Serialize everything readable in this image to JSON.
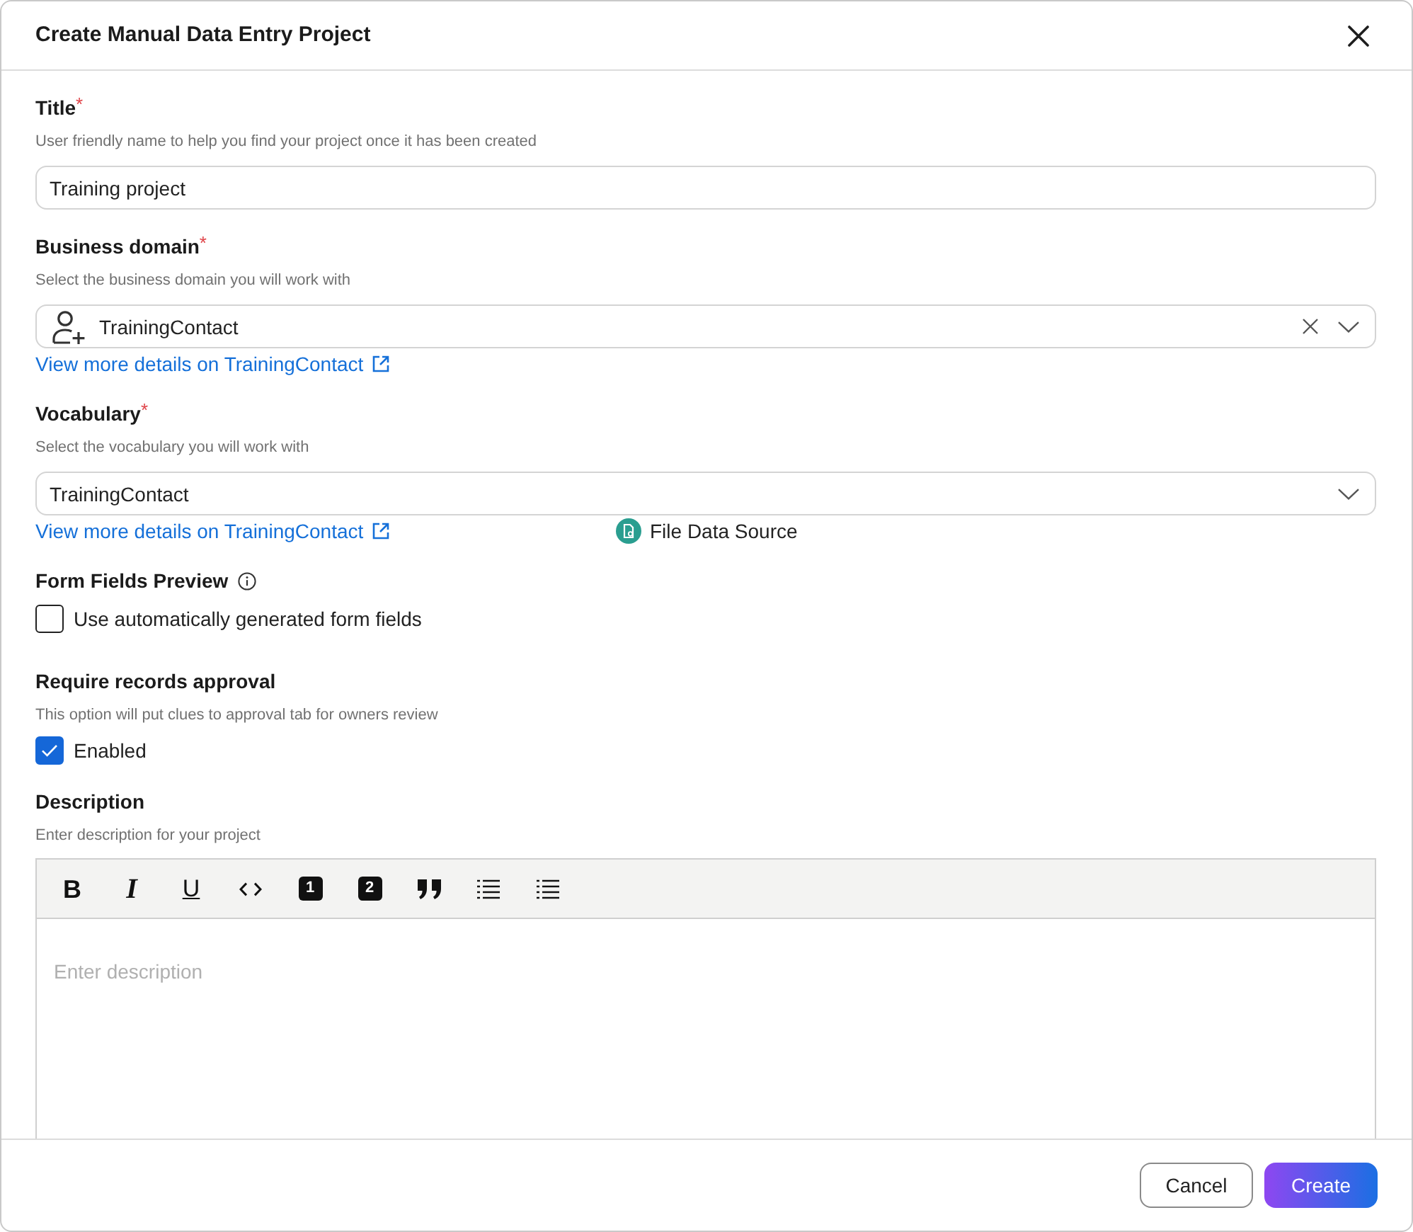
{
  "dialog": {
    "title": "Create Manual Data Entry Project"
  },
  "sections": [
    {
      "kind": "text",
      "label": "Title",
      "required_mark": "*",
      "hint": "User friendly name to help you find your project once it has been created",
      "value": "Training project"
    },
    {
      "kind": "select",
      "label": "Business domain",
      "required_mark": "*",
      "hint": "Select the business domain you will work with",
      "value": "TrainingContact",
      "leading_icon": true,
      "clearable": true,
      "link": "View more details on TrainingContact"
    },
    {
      "kind": "select",
      "label": "Vocabulary",
      "required_mark": "*",
      "hint": "Select the vocabulary you will work with",
      "value": "TrainingContact",
      "leading_icon": false,
      "clearable": false,
      "link": "View more details on TrainingContact",
      "source": "File Data Source"
    },
    {
      "kind": "checkbox",
      "label": "Form Fields Preview",
      "info": true,
      "option": {
        "label": "Use automatically generated form fields",
        "checked": false
      }
    },
    {
      "kind": "checkbox",
      "label": "Require records approval",
      "hint": "This option will put clues to approval tab for owners review",
      "option": {
        "label": "Enabled",
        "checked": true
      }
    },
    {
      "kind": "editor",
      "label": "Description",
      "hint": "Enter description for your project",
      "toolbar": [
        {
          "kind": "bold",
          "label": "B"
        },
        {
          "kind": "italic",
          "label": "I"
        },
        {
          "kind": "underline",
          "label": "U"
        },
        {
          "kind": "code"
        },
        {
          "kind": "heading",
          "label": "1"
        },
        {
          "kind": "heading",
          "label": "2"
        },
        {
          "kind": "quote"
        },
        {
          "kind": "ordered-list"
        },
        {
          "kind": "bullet-list"
        }
      ],
      "placeholder": "Enter description"
    }
  ],
  "buttons": [
    {
      "kind": "secondary",
      "label": "Cancel"
    },
    {
      "kind": "primary",
      "label": "Create"
    }
  ]
}
